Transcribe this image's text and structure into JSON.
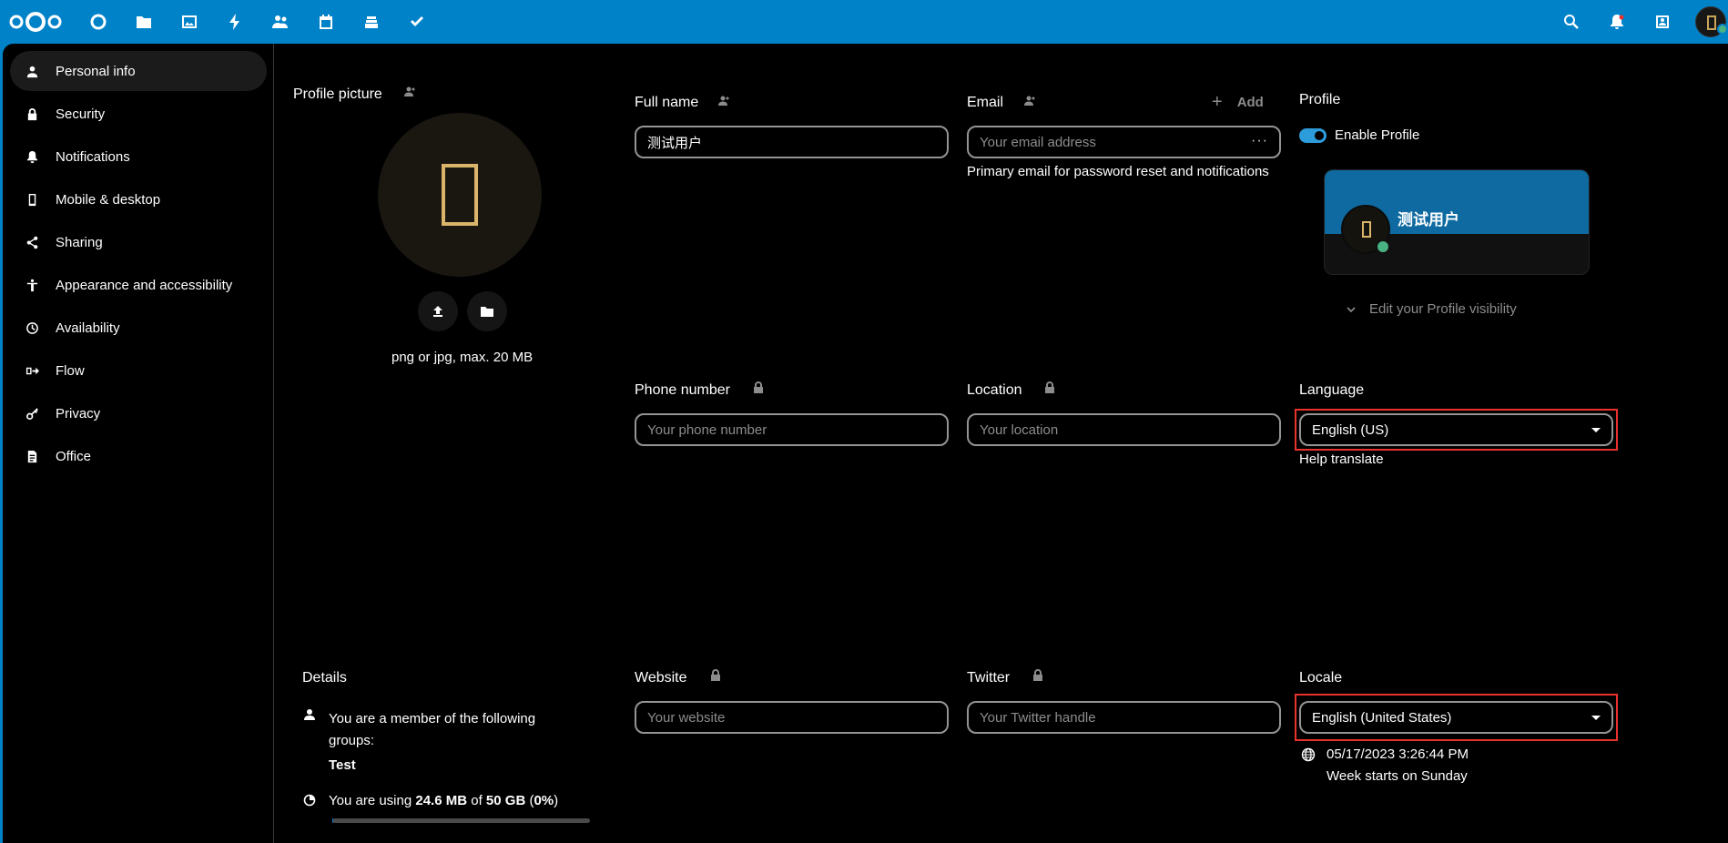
{
  "header": {
    "apps": [
      "dashboard-icon",
      "files-icon",
      "photos-icon",
      "activity-icon",
      "contacts-icon",
      "calendar-icon",
      "deck-icon",
      "tasks-icon"
    ],
    "right": [
      "search-icon",
      "notifications-icon",
      "contacts-menu-icon"
    ]
  },
  "sidebar": {
    "items": [
      {
        "label": "Personal info",
        "icon": "user-icon"
      },
      {
        "label": "Security",
        "icon": "lock-icon"
      },
      {
        "label": "Notifications",
        "icon": "bell-icon"
      },
      {
        "label": "Mobile & desktop",
        "icon": "phone-icon"
      },
      {
        "label": "Sharing",
        "icon": "share-icon"
      },
      {
        "label": "Appearance and accessibility",
        "icon": "accessibility-icon"
      },
      {
        "label": "Availability",
        "icon": "clock-icon"
      },
      {
        "label": "Flow",
        "icon": "flow-icon"
      },
      {
        "label": "Privacy",
        "icon": "key-icon"
      },
      {
        "label": "Office",
        "icon": "document-icon"
      }
    ]
  },
  "profile_picture": {
    "title": "Profile picture",
    "hint": "png or jpg, max. 20 MB"
  },
  "full_name": {
    "label": "Full name",
    "value": "测试用户"
  },
  "email": {
    "label": "Email",
    "add_label": "Add",
    "placeholder": "Your email address",
    "helper": "Primary email for password reset and notifications"
  },
  "profile": {
    "title": "Profile",
    "enable_label": "Enable Profile",
    "enabled": true,
    "card_name": "测试用户",
    "visibility_label": "Edit your Profile visibility"
  },
  "phone": {
    "label": "Phone number",
    "placeholder": "Your phone number"
  },
  "location": {
    "label": "Location",
    "placeholder": "Your location"
  },
  "language": {
    "label": "Language",
    "selected": "English (US)",
    "help_link": "Help translate"
  },
  "details": {
    "title": "Details",
    "groups_text": "You are a member of the following groups:",
    "group_name": "Test",
    "quota_prefix": "You are using ",
    "quota_used": "24.6 MB",
    "quota_of": " of ",
    "quota_total": "50 GB",
    "quota_percent_open": " (",
    "quota_percent": "0%",
    "quota_percent_close": ")",
    "quota_fraction": 0.005
  },
  "website": {
    "label": "Website",
    "placeholder": "Your website"
  },
  "twitter": {
    "label": "Twitter",
    "placeholder": "Your Twitter handle"
  },
  "locale": {
    "label": "Locale",
    "selected": "English (United States)",
    "datetime": "05/17/2023 3:26:44 PM",
    "week_start": "Week starts on Sunday"
  },
  "colors": {
    "brand": "#0082c9",
    "highlight_box": "#e9322d",
    "toggle_on": "#2d9cdb"
  }
}
